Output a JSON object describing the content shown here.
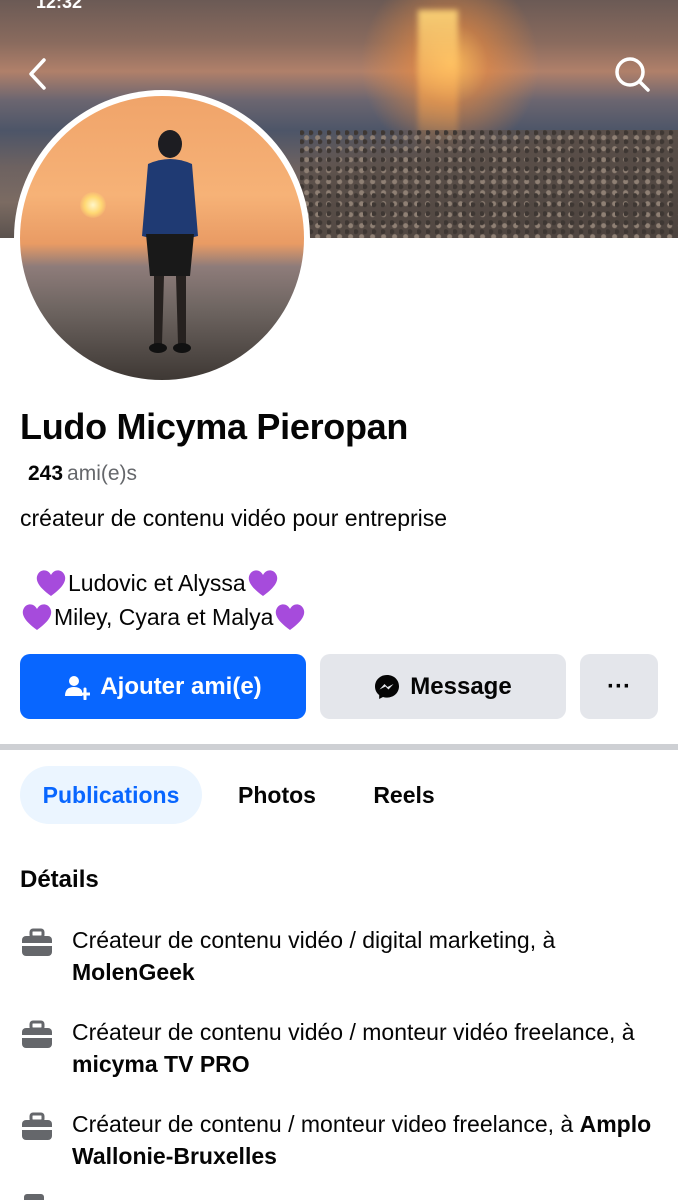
{
  "status_bar": {
    "time": "12:32"
  },
  "profile": {
    "name": "Ludo  Micyma Pieropan",
    "friends_count": "243",
    "friends_label": "ami(e)s",
    "bio": "créateur de contenu vidéo pour entreprise",
    "family_line_1": "Ludovic et Alyssa",
    "family_line_2": "Miley, Cyara et Malya"
  },
  "actions": {
    "add_friend_label": "Ajouter ami(e)",
    "message_label": "Message",
    "more_label": "···"
  },
  "tabs": [
    {
      "label": "Publications",
      "active": true
    },
    {
      "label": "Photos",
      "active": false
    },
    {
      "label": "Reels",
      "active": false
    }
  ],
  "details": {
    "title": "Détails",
    "items": [
      {
        "prefix": "Créateur de contenu vidéo / digital marketing, à ",
        "org": "MolenGeek"
      },
      {
        "prefix": "Créateur de contenu vidéo / monteur vidéo freelance, à ",
        "org": "micyma TV PRO"
      },
      {
        "prefix": "Créateur de contenu / monteur video freelance, à ",
        "org": "Amplo Wallonie-Bruxelles"
      }
    ]
  },
  "icons": {
    "back": "chevron-left-icon",
    "search": "search-icon",
    "add_friend": "add-friend-icon",
    "messenger": "messenger-icon",
    "heart": "purple-heart-icon",
    "work": "briefcase-icon"
  },
  "colors": {
    "primary_blue": "#0866ff",
    "button_gray": "#e4e6eb",
    "tab_active_bg": "#ebf5ff",
    "heart_purple": "#a64bdc",
    "muted_text": "#65676b"
  }
}
